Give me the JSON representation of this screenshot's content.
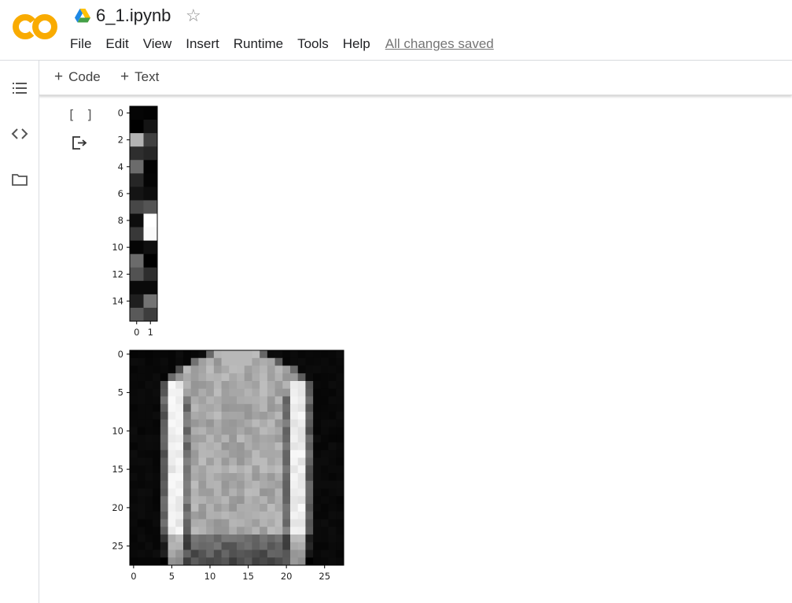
{
  "app": {
    "logo_text": "CO",
    "notebook_title": "6_1.ipynb"
  },
  "menu": {
    "items": [
      "File",
      "Edit",
      "View",
      "Insert",
      "Runtime",
      "Tools",
      "Help"
    ],
    "save_status": "All changes saved"
  },
  "toolbar": {
    "code_label": "Code",
    "text_label": "Text",
    "plus_glyph": "+"
  },
  "cell": {
    "run_bracket": "[ ]"
  },
  "icons": {
    "sidebar": [
      "table-of-contents-icon",
      "code-snippets-icon",
      "files-icon"
    ],
    "output": "output-redirect-icon",
    "star": "star-icon",
    "drive": "drive-icon"
  },
  "colors": {
    "logo_orange": "#F9AB00",
    "logo_light": "#F9C847",
    "link_gray": "#757575"
  },
  "chart_data": [
    {
      "type": "heatmap",
      "colormap": "gray",
      "rows": 16,
      "cols": 2,
      "xticks": [
        0,
        1
      ],
      "yticks": [
        0,
        2,
        4,
        6,
        8,
        10,
        12,
        14
      ],
      "values": [
        [
          0.02,
          0.01
        ],
        [
          0.0,
          0.08
        ],
        [
          0.7,
          0.25
        ],
        [
          0.18,
          0.15
        ],
        [
          0.42,
          0.01
        ],
        [
          0.15,
          0.02
        ],
        [
          0.08,
          0.05
        ],
        [
          0.28,
          0.33
        ],
        [
          0.05,
          1.0
        ],
        [
          0.22,
          0.98
        ],
        [
          0.02,
          0.06
        ],
        [
          0.42,
          0.0
        ],
        [
          0.32,
          0.18
        ],
        [
          0.04,
          0.04
        ],
        [
          0.12,
          0.45
        ],
        [
          0.35,
          0.24
        ]
      ]
    },
    {
      "type": "heatmap",
      "colormap": "gray",
      "rows": 28,
      "cols": 28,
      "xticks": [
        0,
        5,
        10,
        15,
        20,
        25
      ],
      "yticks": [
        0,
        5,
        10,
        15,
        20,
        25
      ],
      "description_of_values": "Fashion-MNIST pullover image, 28x28 grayscale"
    }
  ]
}
